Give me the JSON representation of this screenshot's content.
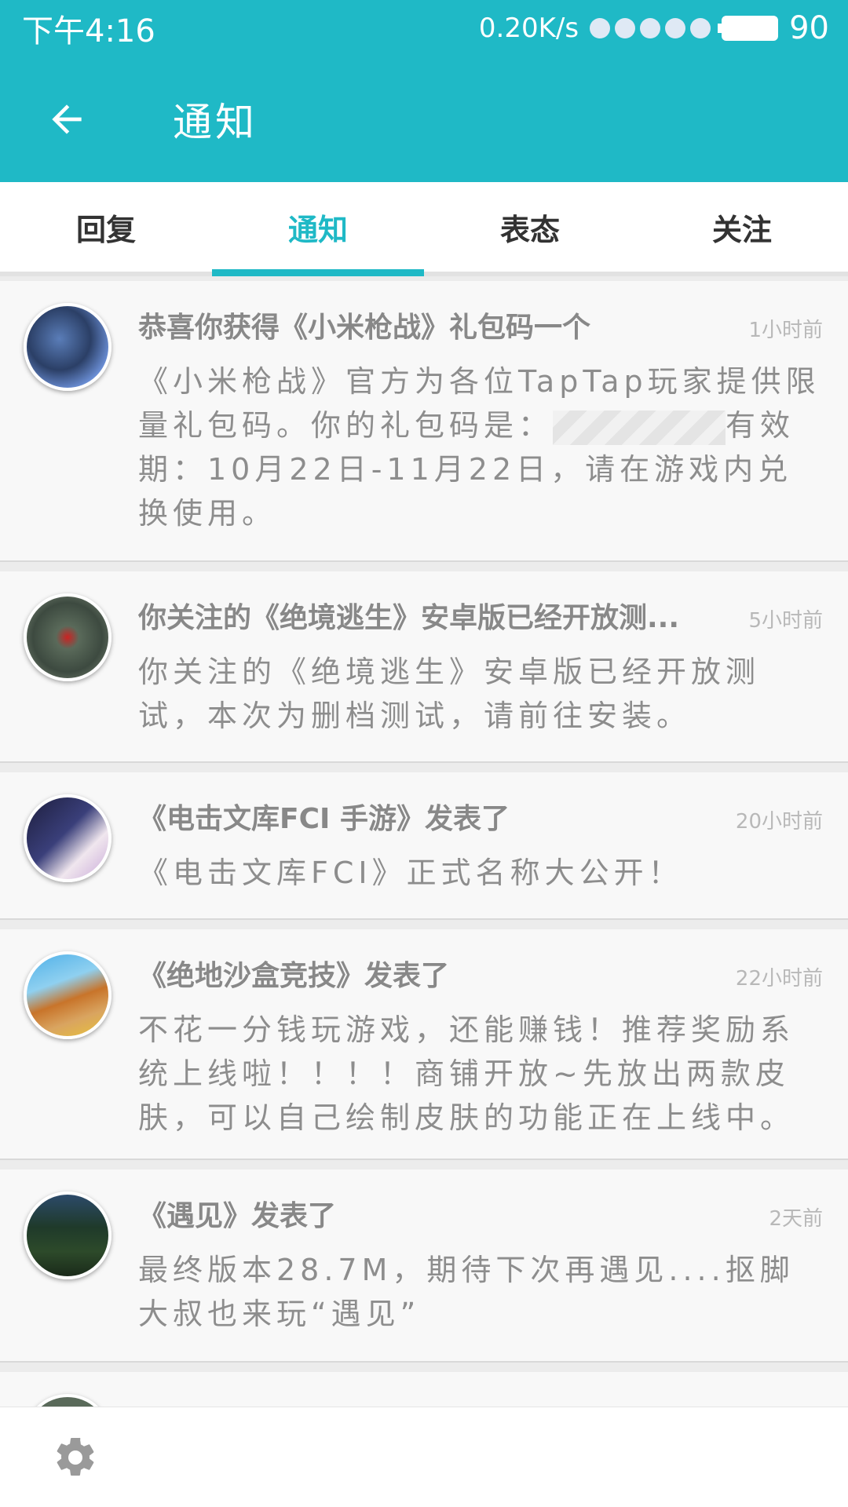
{
  "status_bar": {
    "time": "下午4:16",
    "network_speed": "0.20K/s",
    "battery": "90"
  },
  "app_bar": {
    "title": "通知"
  },
  "tabs": [
    {
      "label": "回复",
      "active": false
    },
    {
      "label": "通知",
      "active": true
    },
    {
      "label": "表态",
      "active": false
    },
    {
      "label": "关注",
      "active": false
    }
  ],
  "notifications": [
    {
      "title": "恭喜你获得《小米枪战》礼包码一个",
      "time": "1小时前",
      "body_before_code": "《小米枪战》官方为各位TapTap玩家提供限量礼包码。你的礼包码是：",
      "body_after_code": "有效期：10月22日-11月22日，请在游戏内兑换使用。"
    },
    {
      "title": "你关注的《绝境逃生》安卓版已经开放测...",
      "time": "5小时前",
      "body": "你关注的《绝境逃生》安卓版已经开放测试，本次为删档测试，请前往安装。"
    },
    {
      "title": "《电击文库FCI 手游》发表了",
      "time": "20小时前",
      "body": "《电击文库FCI》正式名称大公开！"
    },
    {
      "title": "《绝地沙盒竞技》发表了",
      "time": "22小时前",
      "body": "不花一分钱玩游戏，还能赚钱！推荐奖励系统上线啦！！！！商铺开放~先放出两款皮肤，可以自己绘制皮肤的功能正在上线中。"
    },
    {
      "title": "《遇见》发表了",
      "time": "2天前",
      "body": "最终版本28.7M，期待下次再遇见....抠脚大叔也来玩“遇见”"
    }
  ],
  "colors": {
    "accent": "#1fb9c6",
    "card_bg": "#f8f8f8",
    "title_text": "#888888",
    "time_text": "#b8b8b8"
  },
  "icons": {
    "back": "arrow-left-icon",
    "settings": "gear-icon"
  }
}
